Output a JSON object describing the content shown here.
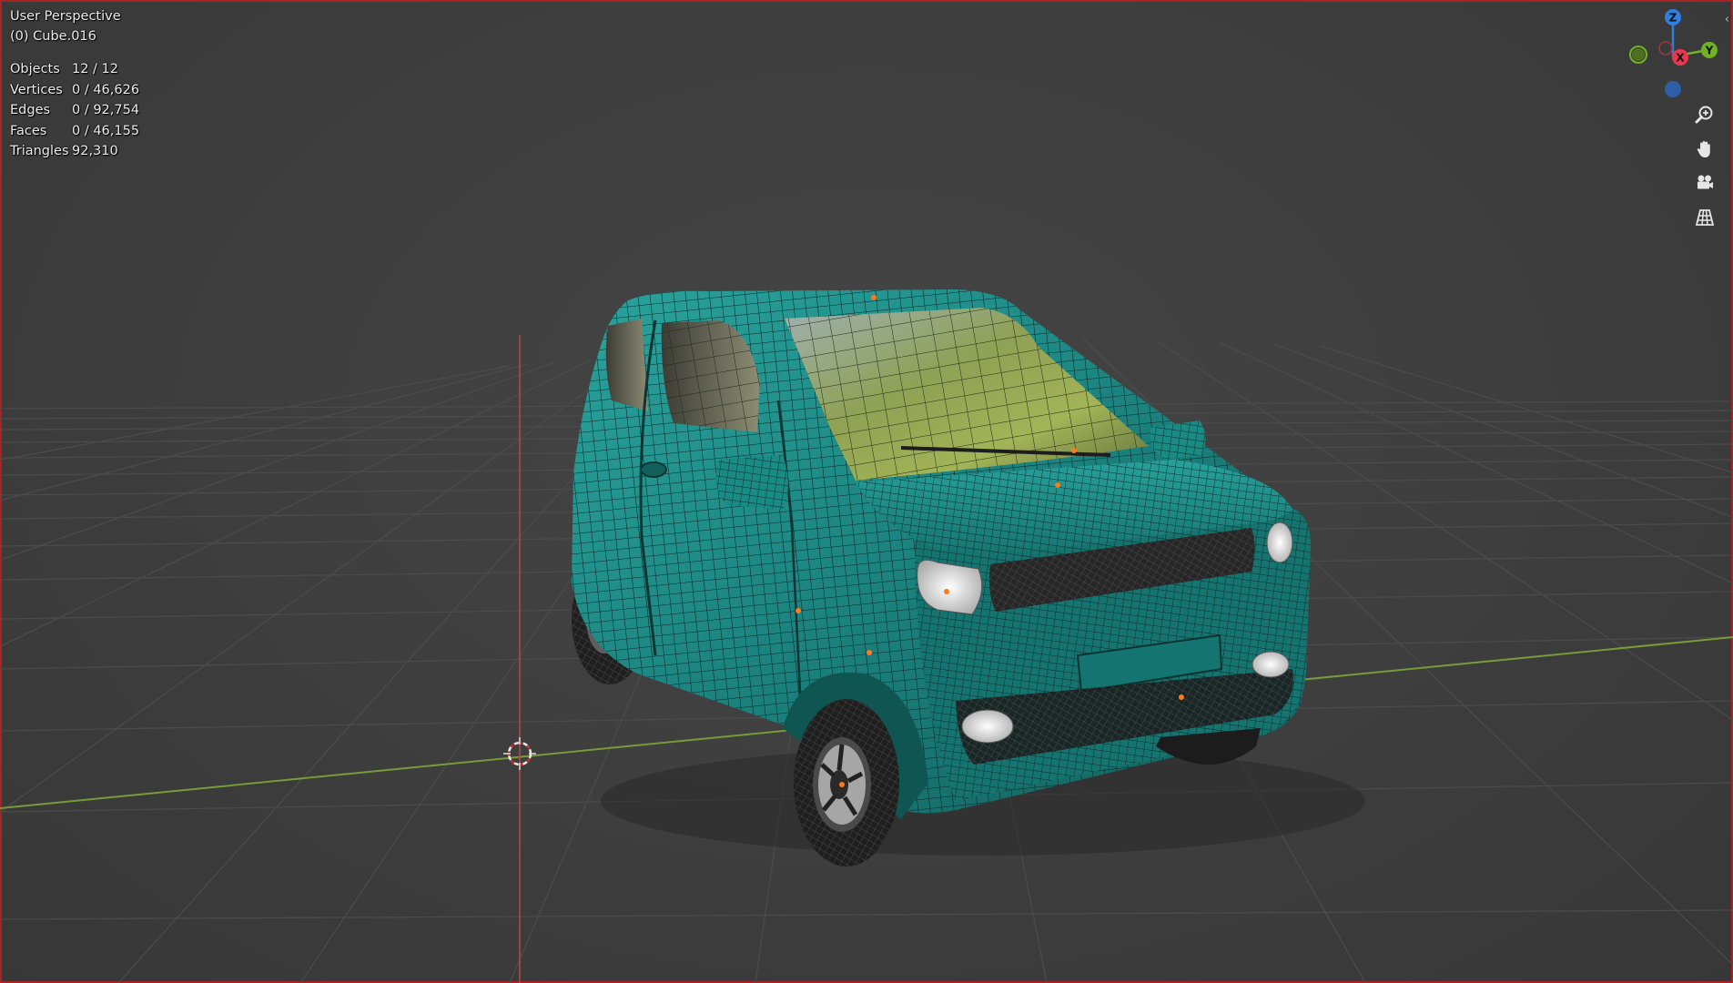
{
  "viewport": {
    "view_name": "User Perspective",
    "active_object": "(0) Cube.016",
    "stats": [
      {
        "key": "objects",
        "label": "Objects",
        "value": "12 / 12"
      },
      {
        "key": "vertices",
        "label": "Vertices",
        "value": "0 / 46,626"
      },
      {
        "key": "edges",
        "label": "Edges",
        "value": "0 / 92,754"
      },
      {
        "key": "faces",
        "label": "Faces",
        "value": "0 / 46,155"
      },
      {
        "key": "triangles",
        "label": "Triangles",
        "value": "92,310"
      }
    ]
  },
  "nav_gizmo": {
    "axes": [
      {
        "label": "Z",
        "color": "#2f7fe0"
      },
      {
        "label": "Y",
        "color": "#6fb324"
      },
      {
        "label": "X",
        "color": "#e8384f"
      }
    ],
    "buttons": [
      {
        "name": "zoom-icon"
      },
      {
        "name": "pan-hand-icon"
      },
      {
        "name": "camera-view-icon"
      },
      {
        "name": "ortho-grid-icon"
      }
    ]
  },
  "colors": {
    "viewport_bg": "#3d3d3d",
    "grid_line": "#4b4b4b",
    "x_axis": "#7a9a3a",
    "z_axis": "#b04a4a",
    "car_body": "#1f8580",
    "window": "#8c9e4f",
    "tire": "#222222",
    "frame_border": "#a82424"
  }
}
